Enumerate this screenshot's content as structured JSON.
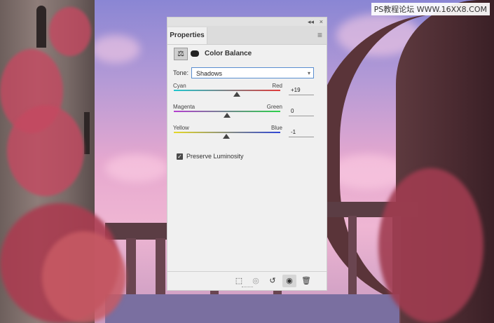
{
  "watermark": "PS教程论坛 WWW.16XX8.COM",
  "panel": {
    "topbar_collapse": "◂◂",
    "topbar_close": "×",
    "tab_label": "Properties",
    "tab_menu_icon": "menu-icon",
    "adjustment_icon": "balance-scale-icon",
    "mask_icon": "mask-icon",
    "title": "Color Balance",
    "tone_label": "Tone:",
    "tone_value": "Shadows",
    "sliders": [
      {
        "left": "Cyan",
        "right": "Red",
        "value": "+19",
        "position": 0.595,
        "gradient": [
          "#21c7cf",
          "#e13b3b"
        ]
      },
      {
        "left": "Magenta",
        "right": "Green",
        "value": "0",
        "position": 0.5,
        "gradient": [
          "#b43fd0",
          "#2bd14a"
        ]
      },
      {
        "left": "Yellow",
        "right": "Blue",
        "value": "-1",
        "position": 0.495,
        "gradient": [
          "#e6d927",
          "#2f46d6"
        ]
      }
    ],
    "preserve_label": "Preserve Luminosity",
    "preserve_checked": true,
    "footer_icons": [
      "clip-to-layer-icon",
      "view-previous-state-icon",
      "reset-icon",
      "visibility-eye-icon",
      "trash-icon"
    ]
  }
}
